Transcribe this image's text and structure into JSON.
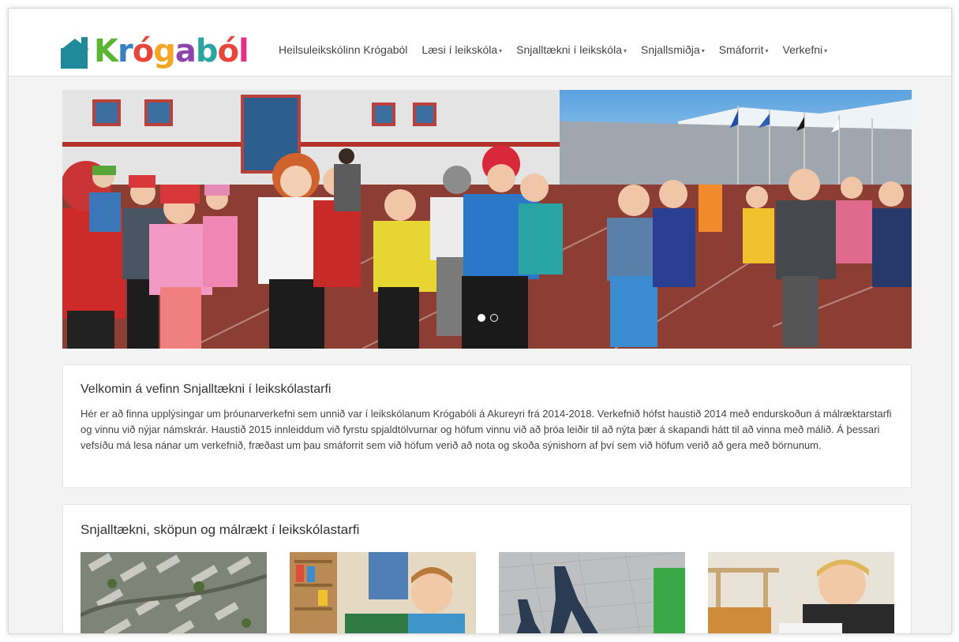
{
  "logo": {
    "text": "Krógaból",
    "letters": [
      {
        "ch": "K",
        "color": "#5ab533"
      },
      {
        "ch": "r",
        "color": "#3a7fc1"
      },
      {
        "ch": "ó",
        "color": "#e8463a"
      },
      {
        "ch": "g",
        "color": "#f5a623"
      },
      {
        "ch": "a",
        "color": "#8e44ad"
      },
      {
        "ch": "b",
        "color": "#2aa6a0"
      },
      {
        "ch": "ó",
        "color": "#e8463a"
      },
      {
        "ch": "l",
        "color": "#e5308a"
      }
    ],
    "house_color": "#1f8a9a"
  },
  "nav": {
    "items": [
      {
        "label": "Heilsuleikskólinn Krógaból",
        "has_dropdown": false
      },
      {
        "label": "Læsi í leikskóla",
        "has_dropdown": true
      },
      {
        "label": "Snjalltækni í leikskóla",
        "has_dropdown": true
      },
      {
        "label": "Snjallsmiðja",
        "has_dropdown": true
      },
      {
        "label": "Smáforrit",
        "has_dropdown": true
      },
      {
        "label": "Verkefni",
        "has_dropdown": true
      }
    ],
    "caret": "▾"
  },
  "hero": {
    "carousel_slides": 2,
    "active_slide": 1
  },
  "welcome": {
    "title": "Velkomin á vefinn Snjalltækni í leikskólastarfi",
    "body": "Hér er að finna upplýsingar um þróunarverkefni sem unnið var í leikskólanum Krógabóli á Akureyri frá 2014-2018. Verkefnið hófst haustið 2014 með endurskoðun á málræktarstarfi og vinnu við nýjar námskrár. Haustið 2015 innleiddum við fyrstu spjaldtölvurnar og höfum vinnu við að þróa leiðir til að nýta þær á skapandi hátt til að vinna með málið. Á þessari vefsíðu má lesa nánar um verkefnið, fræðast um þau smáforrit sem við höfum verið að nota og skoða sýnishorn af því sem við höfum verið að gera með börnunum."
  },
  "projects": {
    "title": "Snjalltækni, sköpun og málrækt í leikskólastarfi",
    "thumbnails": [
      {
        "name": "aerial-map-thumbnail"
      },
      {
        "name": "child-at-shelves-thumbnail"
      },
      {
        "name": "shadows-thumbnail"
      },
      {
        "name": "child-drawing-thumbnail"
      }
    ]
  }
}
